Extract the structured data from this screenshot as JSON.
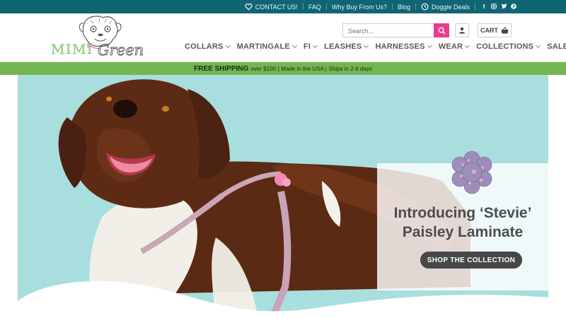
{
  "topbar": {
    "contact": "CONTACT US!",
    "faq": "FAQ",
    "why_buy": "Why Buy From Us?",
    "blog": "Blog",
    "deals": "Doggie Deals",
    "social": [
      "f",
      "ig",
      "tw",
      "p"
    ]
  },
  "logo": {
    "text_a": "MIMI",
    "text_b": "Green"
  },
  "search": {
    "placeholder": "Search..."
  },
  "cart": {
    "label": "CART"
  },
  "nav": {
    "items": [
      "COLLARS",
      "MARTINGALE",
      "FI",
      "LEASHES",
      "HARNESSES",
      "WEAR",
      "COLLECTIONS",
      "SALE"
    ]
  },
  "promo": {
    "headline": "FREE SHIPPING",
    "detail_1": "over $100",
    "detail_2": "| Made in the USA |",
    "detail_3": "Ships in 2-6 days"
  },
  "hero": {
    "title_line_1": "Introducing ‘Stevie’",
    "title_line_2": "Paisley Laminate",
    "cta": "SHOP THE COLLECTION"
  },
  "colors": {
    "topbar": "#0f6672",
    "promo": "#73b550",
    "search_button": "#e93e8f",
    "hero_bg": "#a9dede",
    "cta": "#474747"
  }
}
